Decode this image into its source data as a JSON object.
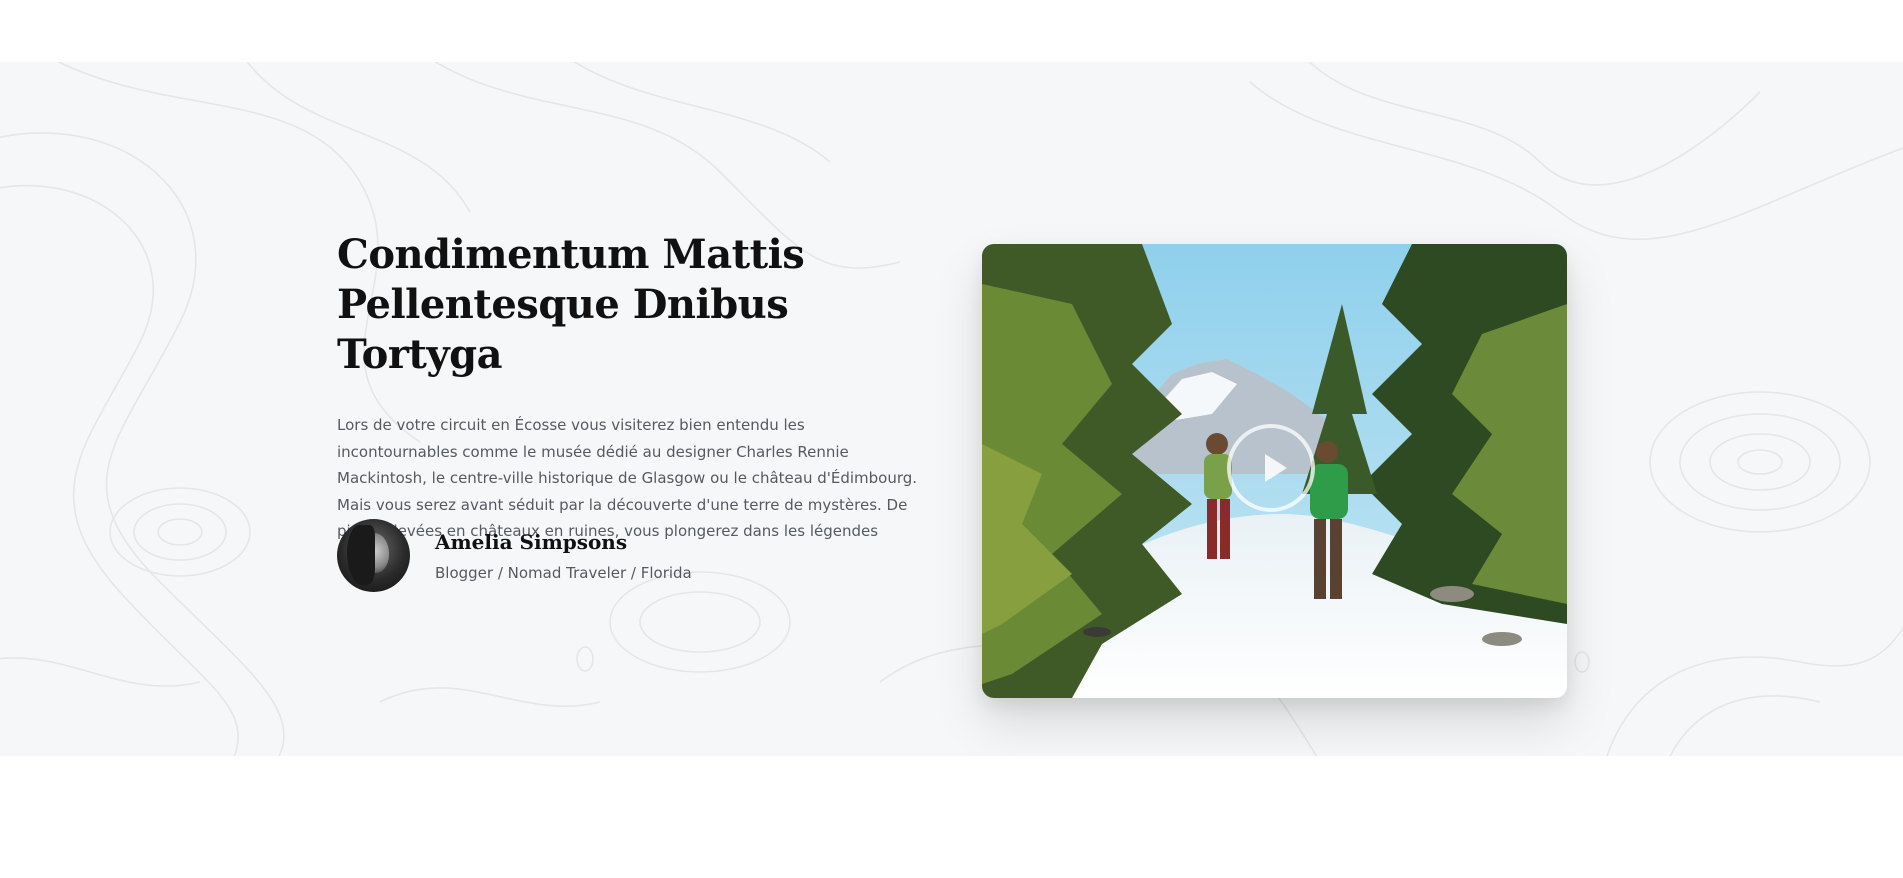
{
  "feature": {
    "title_line1": "Condimentum Mattis",
    "title_line2": "Pellentesque Dnibus Tortyga",
    "description": "Lors de votre circuit en Écosse vous visiterez bien entendu les incontournables comme le musée dédié au designer Charles Rennie Mackintosh, le centre-ville historique de Glasgow ou le château d'Édimbourg. Mais vous serez avant séduit par la découverte d'une terre de mystères. De pierres levées en châteaux en ruines, vous plongerez dans les légendes"
  },
  "author": {
    "name": "Amelia Simpsons",
    "role": "Blogger / Nomad Traveler / Florida",
    "avatar_icon": "avatar-photo"
  },
  "video": {
    "play_icon": "play-icon"
  },
  "colors": {
    "section_bg": "#f6f7f9",
    "title": "#111111",
    "text": "#555a60"
  }
}
